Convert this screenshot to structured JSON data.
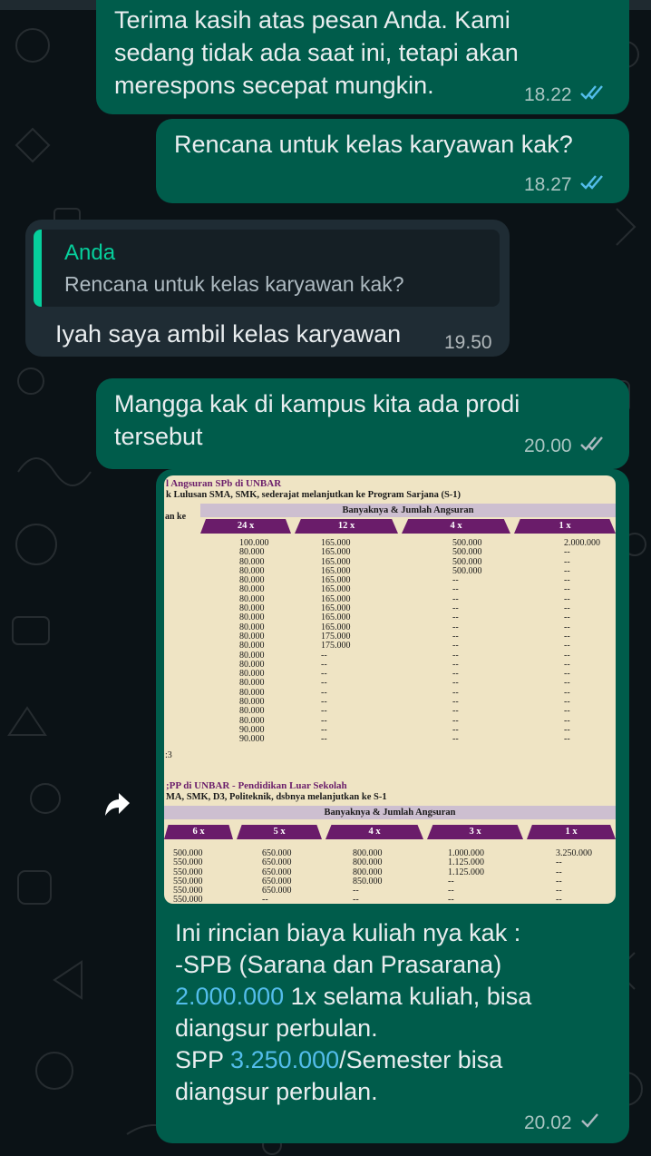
{
  "chat": {
    "messages": [
      {
        "lines": [
          "Terima kasih atas pesan Anda. Kami",
          "sedang tidak ada saat ini, tetapi akan",
          "merespons secepat mungkin."
        ],
        "time": "18.22",
        "status": "read",
        "direction": "outgoing"
      },
      {
        "lines": [
          "Rencana untuk kelas karyawan kak?"
        ],
        "time": "18.27",
        "status": "read",
        "direction": "outgoing"
      },
      {
        "quote_author": "Anda",
        "quote_text": "Rencana untuk kelas karyawan kak?",
        "lines": [
          "Iyah saya ambil kelas karyawan"
        ],
        "time": "19.50",
        "direction": "incoming"
      },
      {
        "lines": [
          "Mangga kak di kampus kita ada prodi",
          "tersebut"
        ],
        "time": "20.00",
        "status": "delivered",
        "direction": "outgoing"
      },
      {
        "caption_lines": [
          {
            "parts": [
              "Ini rincian biaya kuliah nya kak :"
            ]
          },
          {
            "parts": [
              "-SPB (Sarana dan Prasarana)"
            ]
          },
          {
            "link": "2.000.000",
            "after": " 1x selama kuliah, bisa"
          },
          {
            "parts": [
              "diangsur perbulan."
            ]
          },
          {
            "before": "SPP ",
            "link": "3.250.000",
            "after": "/Semester bisa"
          },
          {
            "parts": [
              "diangsur perbulan."
            ]
          }
        ],
        "time": "20.02",
        "status": "sent",
        "direction": "outgoing"
      }
    ]
  },
  "image": {
    "s1_title": "l Angsuran SPb di UNBAR",
    "s1_sub": "k Lulusan SMA, SMK, sederajat melanjutkan ke Program Sarjana (S-1)",
    "s1_band": "Banyaknya & Jumlah Angsuran",
    "s1_side": "an ke",
    "s1_cols": [
      "24 x",
      "12 x",
      "4 x",
      "1 x"
    ],
    "s1_row_label": ":3",
    "s1_c1": "100.000\n80.000\n80.000\n80.000\n80.000\n80.000\n80.000\n80.000\n80.000\n80.000\n80.000\n80.000\n80.000\n80.000\n80.000\n80.000\n80.000\n80.000\n80.000\n80.000\n90.000\n90.000",
    "s1_c2": "165.000\n165.000\n165.000\n165.000\n165.000\n165.000\n165.000\n165.000\n165.000\n165.000\n175.000\n175.000\n--\n--\n--\n--\n--\n--\n--\n--\n--\n--",
    "s1_c3": "500.000\n500.000\n500.000\n500.000\n--\n--\n--\n--\n--\n--\n--\n--\n--\n--\n--\n--\n--\n--\n--\n--\n--\n--",
    "s1_c4": "2.000.000\n--\n--\n--\n--\n--\n--\n--\n--\n--\n--\n--\n--\n--\n--\n--\n--\n--\n--\n--\n--\n--",
    "s2_title": ";PP di UNBAR - Pendidikan Luar Sekolah",
    "s2_sub": "MA, SMK, D3, Politeknik, dsbnya melanjutkan ke S-1",
    "s2_band": "Banyaknya & Jumlah Angsuran",
    "s2_cols": [
      "6 x",
      "5 x",
      "4 x",
      "3 x",
      "1 x"
    ],
    "s2_c1": "500.000\n550.000\n550.000\n550.000\n550.000\n550.000",
    "s2_c2": "650.000\n650.000\n650.000\n650.000\n650.000\n--",
    "s2_c3": "800.000\n800.000\n800.000\n850.000\n--\n--",
    "s2_c4": "1.000.000\n1.125.000\n1.125.000\n--\n--\n--",
    "s2_c5": "3.250.000\n--\n--\n--\n--\n--"
  },
  "colors": {
    "outgoing_bubble": "#005c4b",
    "incoming_bubble": "#1f2c34",
    "background": "#0b1216",
    "read_ticks": "#53bdeb",
    "quote_accent": "#06cf9c",
    "link": "#53bdeb"
  },
  "icons": [
    "double-check-icon",
    "single-check-icon",
    "forward-icon"
  ]
}
